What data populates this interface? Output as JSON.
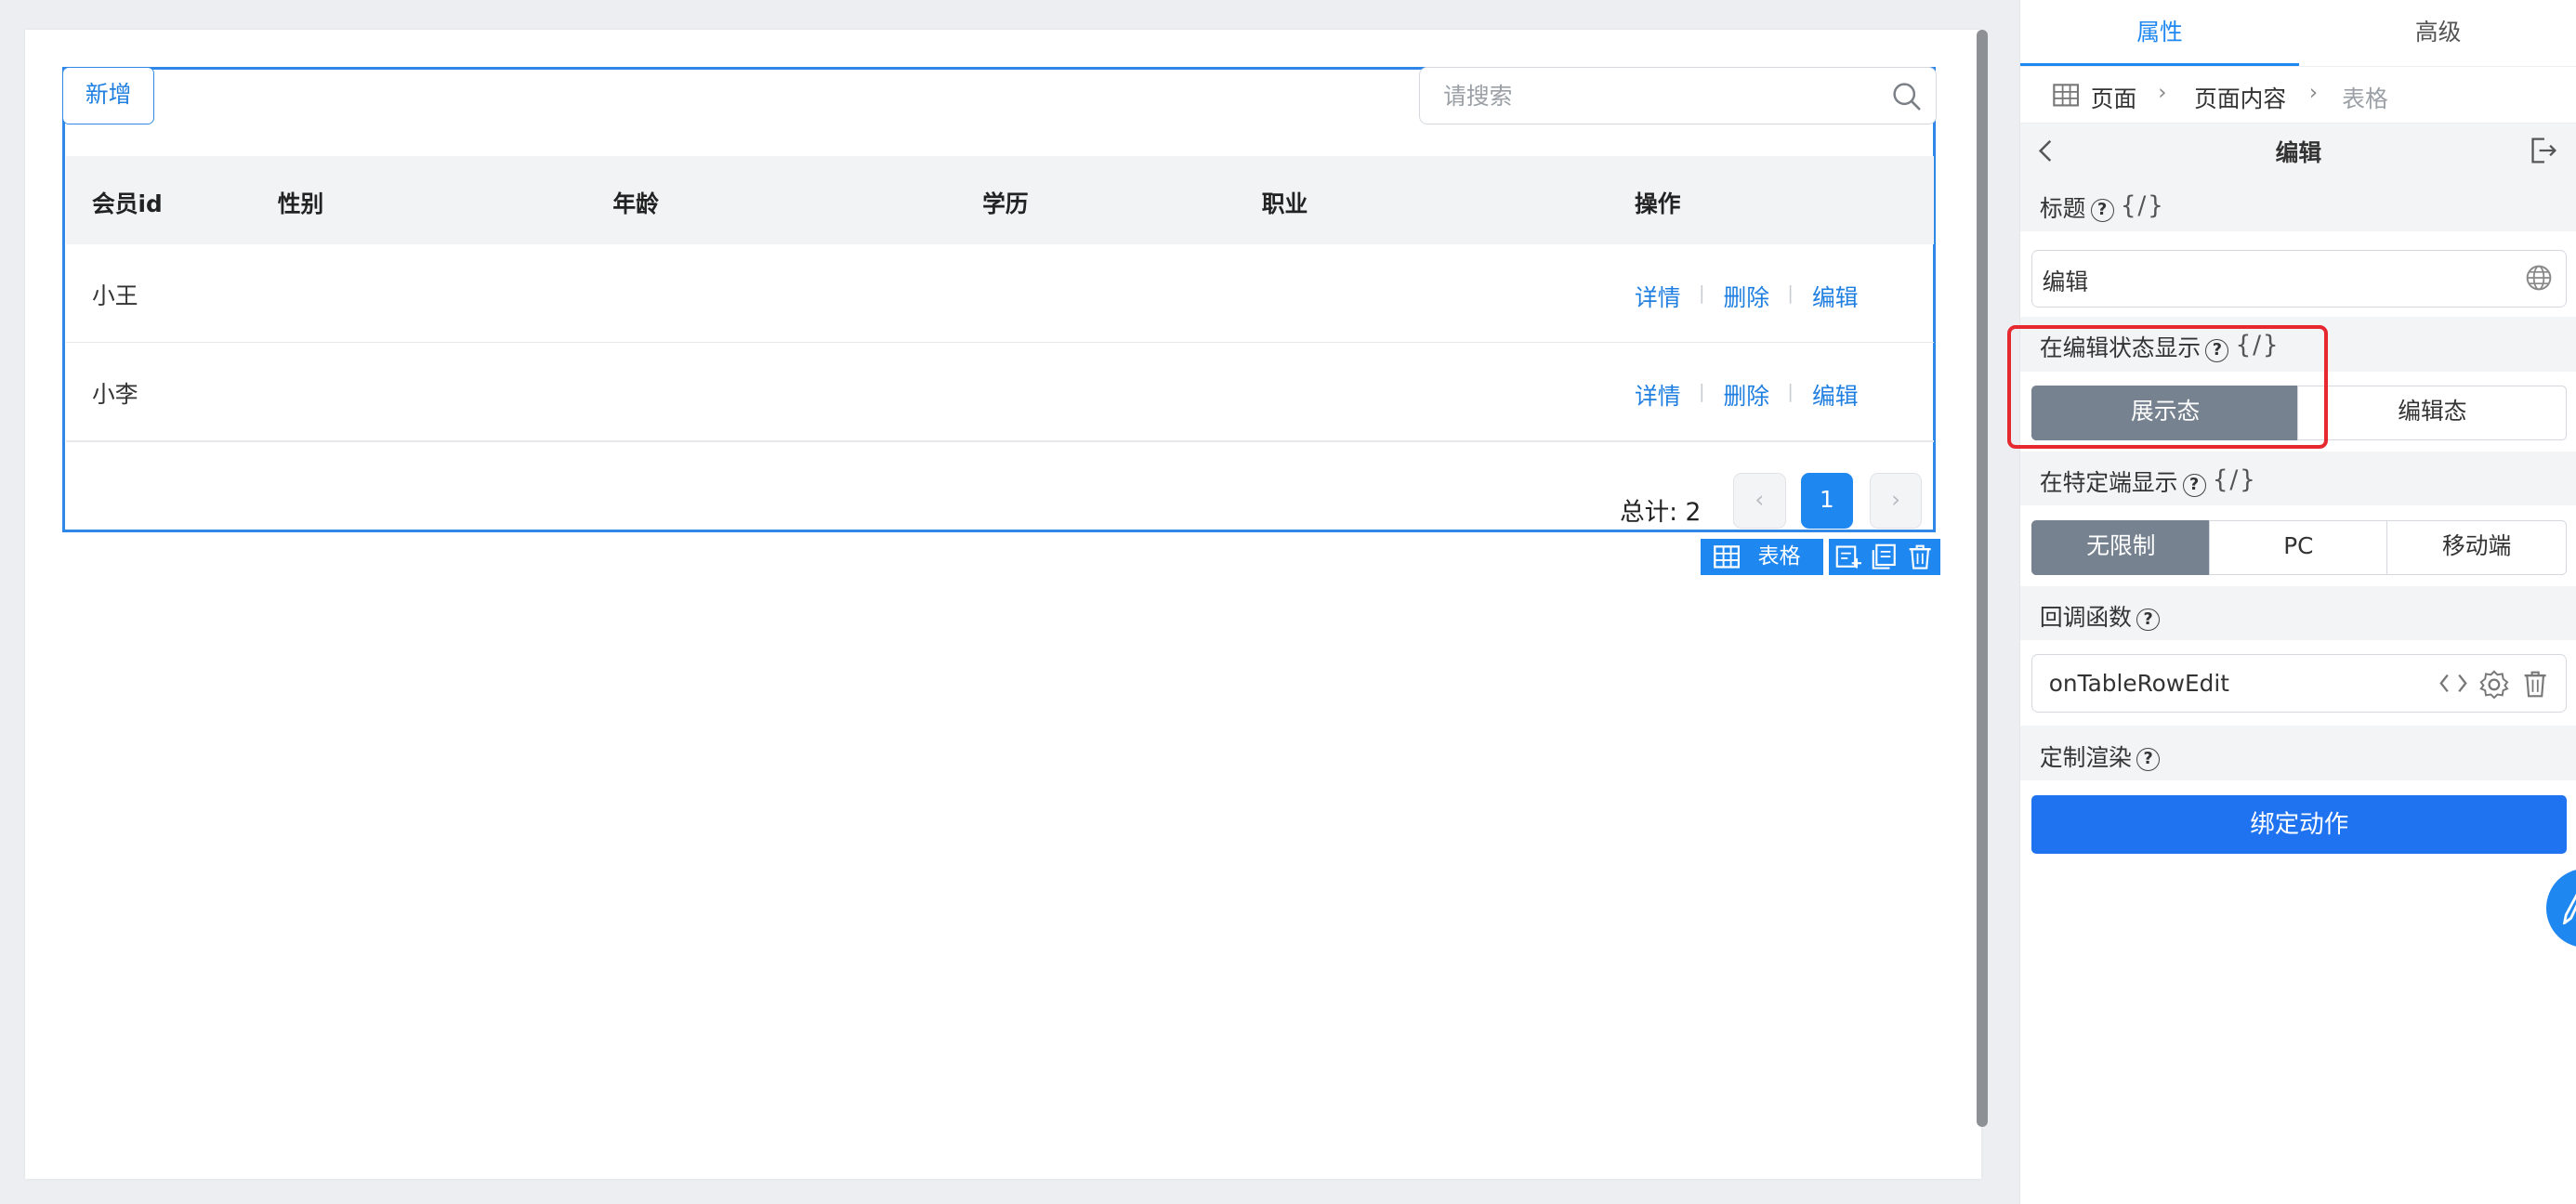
{
  "table": {
    "add_button": "新增",
    "search_placeholder": "请搜索",
    "columns": [
      "会员id",
      "性别",
      "年龄",
      "学历",
      "职业",
      "操作"
    ],
    "rows": [
      {
        "name": "小王",
        "ops": [
          "详情",
          "删除",
          "编辑"
        ]
      },
      {
        "name": "小李",
        "ops": [
          "详情",
          "删除",
          "编辑"
        ]
      }
    ],
    "separator": "|",
    "total_label": "总计: 2",
    "pagination": {
      "prev": "‹",
      "current": "1",
      "next": "›"
    }
  },
  "component_tag": {
    "label": "表格",
    "icon": "table-icon",
    "tools": [
      "add-child-icon",
      "copy-icon",
      "trash-icon"
    ]
  },
  "panel": {
    "tabs": [
      "属性",
      "高级"
    ],
    "breadcrumb": [
      "页面",
      "页面内容",
      "表格"
    ],
    "crumb_sep": "›",
    "edit_title": "编辑",
    "help_mark": "?",
    "braces": "{/}",
    "title_label": "标题",
    "title_value": "编辑",
    "edit_state_label": "在编辑状态显示",
    "edit_state_options": [
      "展示态",
      "编辑态"
    ],
    "edit_state_selected": "展示态",
    "platform_label": "在特定端显示",
    "platform_options": [
      "无限制",
      "PC",
      "移动端"
    ],
    "platform_selected": "无限制",
    "callback_label": "回调函数",
    "callback_value": "onTableRowEdit",
    "custom_render_label": "定制渲染",
    "bind_button": "绑定动作"
  },
  "colors": {
    "accent": "#1f87f0",
    "selected_segment": "#76828f",
    "highlight_box": "#e5292f"
  }
}
